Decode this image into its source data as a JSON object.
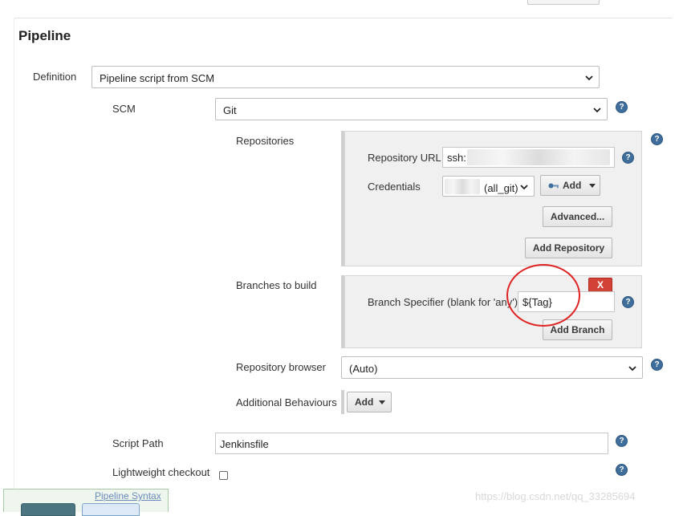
{
  "section": {
    "title": "Pipeline"
  },
  "definition": {
    "label": "Definition",
    "value": "Pipeline script from SCM"
  },
  "scm": {
    "label": "SCM",
    "value": "Git"
  },
  "repositories": {
    "label": "Repositories",
    "url_label": "Repository URL",
    "url_value": "ssh:",
    "credentials_label": "Credentials",
    "credentials_value": "(all_git)",
    "add_label": "Add",
    "advanced_label": "Advanced...",
    "add_repository_label": "Add Repository"
  },
  "branches": {
    "label": "Branches to build",
    "delete_label": "X",
    "specifier_label": "Branch Specifier (blank for 'any')",
    "specifier_value": "${Tag}",
    "add_branch_label": "Add Branch"
  },
  "repository_browser": {
    "label": "Repository browser",
    "value": "(Auto)"
  },
  "additional_behaviours": {
    "label": "Additional Behaviours",
    "add_label": "Add"
  },
  "script_path": {
    "label": "Script Path",
    "value": "Jenkinsfile"
  },
  "lightweight_checkout": {
    "label": "Lightweight checkout",
    "checked": false
  },
  "pipeline_syntax_link": "Pipeline Syntax",
  "watermark": "https://blog.csdn.net/qq_33285694",
  "help_glyph": "?",
  "colors": {
    "help": "#3f6e9c",
    "delete": "#d24236",
    "highlight_circle": "#e02424",
    "link": "#6b8bbb"
  }
}
